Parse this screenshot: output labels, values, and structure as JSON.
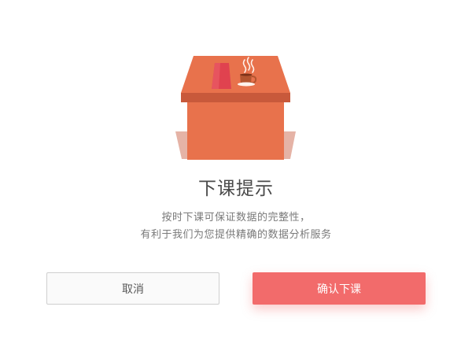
{
  "dialog": {
    "title": "下课提示",
    "description_line1": "按时下课可保证数据的完整性，",
    "description_line2": "有利于我们为您提供精确的数据分析服务",
    "cancel_label": "取消",
    "confirm_label": "确认下课"
  },
  "colors": {
    "accent": "#f26b6b",
    "desk": "#e8724c",
    "desk_dark": "#c8593b",
    "cup": "#e0424f",
    "mug": "#b3542f",
    "shadow": "#e5b3a6"
  },
  "icons": {
    "illustration": "desk-with-cup-and-coffee-icon"
  }
}
